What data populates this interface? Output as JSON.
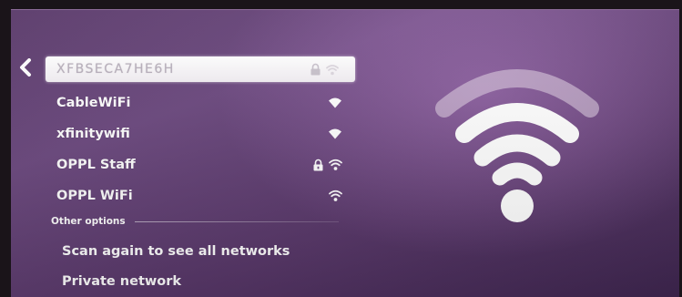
{
  "networks": [
    {
      "name": "XFBSECA7HE6H",
      "locked": true,
      "signal": "wifi-icon",
      "focused": true
    },
    {
      "name": "CableWiFi",
      "locked": false,
      "signal": "wifi-icon"
    },
    {
      "name": "xfinitywifi",
      "locked": false,
      "signal": "wifi-icon"
    },
    {
      "name": "OPPL Staff",
      "locked": true,
      "signal": "wifi-icon"
    },
    {
      "name": "OPPL WiFi",
      "locked": false,
      "signal": "wifi-icon"
    }
  ],
  "other_options": {
    "label": "Other options",
    "items": [
      {
        "label": "Scan again to see all networks"
      },
      {
        "label": "Private network"
      }
    ]
  },
  "icons": {
    "back": "chevron-left-icon",
    "lock": "lock-icon",
    "signal": "wifi-icon",
    "hero": "wifi-large-icon"
  },
  "colors": {
    "background": "#6d4a80",
    "text": "#ffffff",
    "focused_bg": "#ffffff",
    "focused_text": "#b9b0bd"
  }
}
